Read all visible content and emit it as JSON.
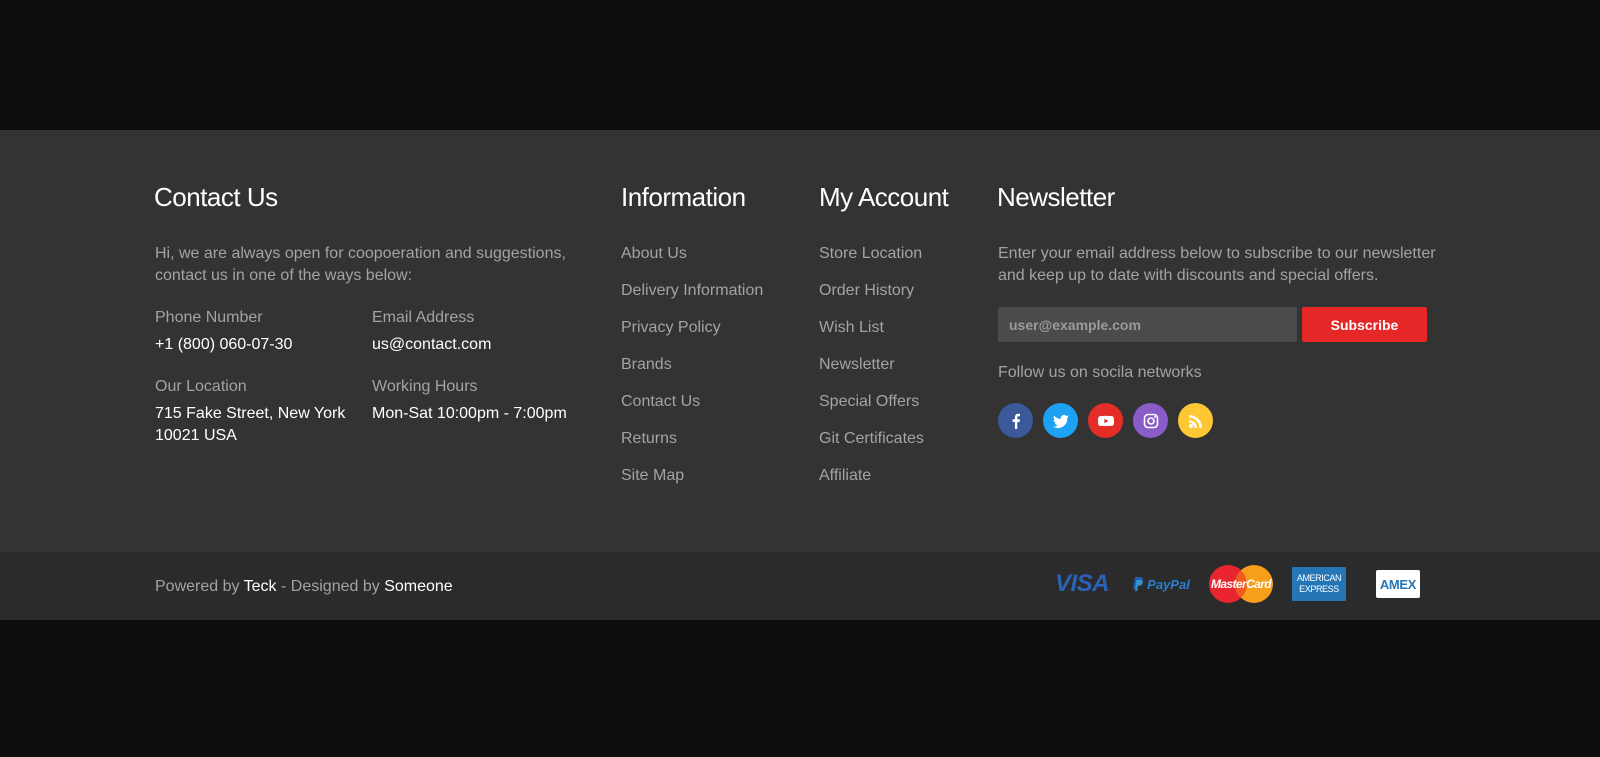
{
  "contact": {
    "title": "Contact Us",
    "intro_line1": "Hi, we are always open for coopoeration and suggestions,",
    "intro_line2": "contact us in one of the ways below:",
    "phone_label": "Phone Number",
    "phone_value": "+1 (800) 060-07-30",
    "email_label": "Email Address",
    "email_value": "us@contact.com",
    "location_label": "Our Location",
    "location_line1": "715 Fake Street, New York",
    "location_line2": "10021 USA",
    "hours_label": "Working Hours",
    "hours_value": "Mon-Sat 10:00pm - 7:00pm"
  },
  "information": {
    "title": "Information",
    "links": [
      "About Us",
      "Delivery Information",
      "Privacy Policy",
      "Brands",
      "Contact Us",
      "Returns",
      "Site Map"
    ]
  },
  "account": {
    "title": "My Account",
    "links": [
      "Store Location",
      "Order History",
      "Wish List",
      "Newsletter",
      "Special Offers",
      "Git Certificates",
      "Affiliate"
    ]
  },
  "newsletter": {
    "title": "Newsletter",
    "text_line1": "Enter your email address below to subscribe to our newsletter",
    "text_line2": "and keep up to date with discounts and special offers.",
    "placeholder": "user@example.com",
    "subscribe_label": "Subscribe",
    "follow_text": "Follow us on socila networks",
    "social": [
      {
        "icon": "facebook-icon",
        "color": "#3b5998"
      },
      {
        "icon": "twitter-icon",
        "color": "#1da1f2"
      },
      {
        "icon": "youtube-icon",
        "color": "#e52d27"
      },
      {
        "icon": "instagram-icon",
        "color": "#8a5cc7"
      },
      {
        "icon": "rss-icon",
        "color": "#ffc733"
      }
    ]
  },
  "bottom": {
    "powered_prefix": "Powered by",
    "powered_name": "Teck",
    "designed_prefix": "- Designed by",
    "designed_name": "Someone",
    "payments": {
      "visa": "VISA",
      "paypal": "PayPal",
      "mastercard": "MasterCard",
      "amex_line1": "AMERICAN",
      "amex_line2": "EXPRESS",
      "amex_short": "AMEX"
    }
  },
  "colors": {
    "page_bg": "#0d0d0d",
    "footer_bg": "#333333",
    "bottom_bar_bg": "#2b2b2b",
    "accent": "#e52727"
  }
}
